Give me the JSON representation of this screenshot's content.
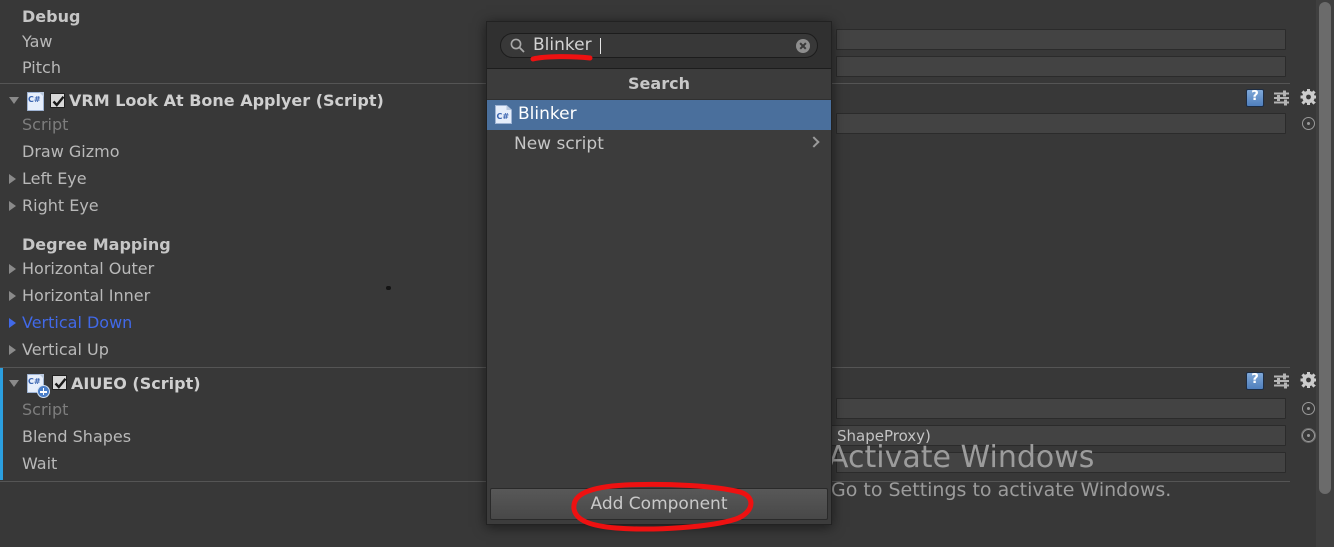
{
  "app": {
    "name": "Unity Editor Inspector",
    "accent_blue": "#4169e8",
    "selection_blue": "#2b9fe0",
    "popup_selection_blue": "#4a6f9c",
    "annotation_color": "#ee1111"
  },
  "inspector": {
    "debug_section": {
      "heading": "Debug",
      "rows": [
        "Yaw",
        "Pitch"
      ]
    },
    "components": [
      {
        "title": "VRM Look At Bone Applyer (Script)",
        "enabled": true,
        "icon": "csharp-script-icon",
        "header_icons": [
          "help-icon",
          "preset-icon",
          "gear-icon"
        ],
        "rows": [
          {
            "label": "Script",
            "dim": true,
            "foldout": false
          },
          {
            "label": "Draw Gizmo",
            "dim": false,
            "foldout": false
          },
          {
            "label": "Left Eye",
            "dim": false,
            "foldout": true
          },
          {
            "label": "Right Eye",
            "dim": false,
            "foldout": true
          }
        ],
        "subsection": {
          "heading": "Degree Mapping",
          "rows": [
            {
              "label": "Horizontal Outer",
              "foldout": true,
              "highlighted": false
            },
            {
              "label": "Horizontal Inner",
              "foldout": true,
              "highlighted": false
            },
            {
              "label": "Vertical Down",
              "foldout": true,
              "highlighted": true
            },
            {
              "label": "Vertical Up",
              "foldout": true,
              "highlighted": false
            }
          ]
        }
      },
      {
        "title": "AIUEO (Script)",
        "enabled": true,
        "icon": "csharp-script-add-icon",
        "header_icons": [
          "help-icon",
          "preset-icon",
          "gear-icon"
        ],
        "selected": true,
        "rows": [
          {
            "label": "Script",
            "dim": true,
            "foldout": false
          },
          {
            "label": "Blend Shapes",
            "dim": false,
            "foldout": false
          },
          {
            "label": "Wait",
            "dim": false,
            "foldout": false
          }
        ]
      }
    ],
    "object_fields": [
      {
        "value": "",
        "has_target_picker": false
      },
      {
        "value": "",
        "has_target_picker": false
      },
      {
        "value": "",
        "has_target_picker": true
      },
      {
        "value": "",
        "has_target_picker": true
      },
      {
        "value": "ShapeProxy)",
        "has_target_picker": true
      },
      {
        "value": "",
        "has_target_picker": false
      }
    ]
  },
  "popup": {
    "name": "add-component-popup",
    "search": {
      "value": "Blinker",
      "placeholder": "Search",
      "icon": "search-icon",
      "clear_icon": "clear-icon"
    },
    "header": "Search",
    "items": [
      {
        "label": "Blinker",
        "icon": "csharp-script-icon",
        "selected": true,
        "has_submenu": false
      },
      {
        "label": "New script",
        "icon": "",
        "selected": false,
        "has_submenu": true
      }
    ],
    "footer_button": "Add Component"
  },
  "watermark": {
    "title": "Activate Windows",
    "subtitle": "Go to Settings to activate Windows."
  },
  "annotations": [
    {
      "name": "underline-search-text",
      "shape": "underline"
    },
    {
      "name": "circle-add-component",
      "shape": "ellipse"
    }
  ]
}
